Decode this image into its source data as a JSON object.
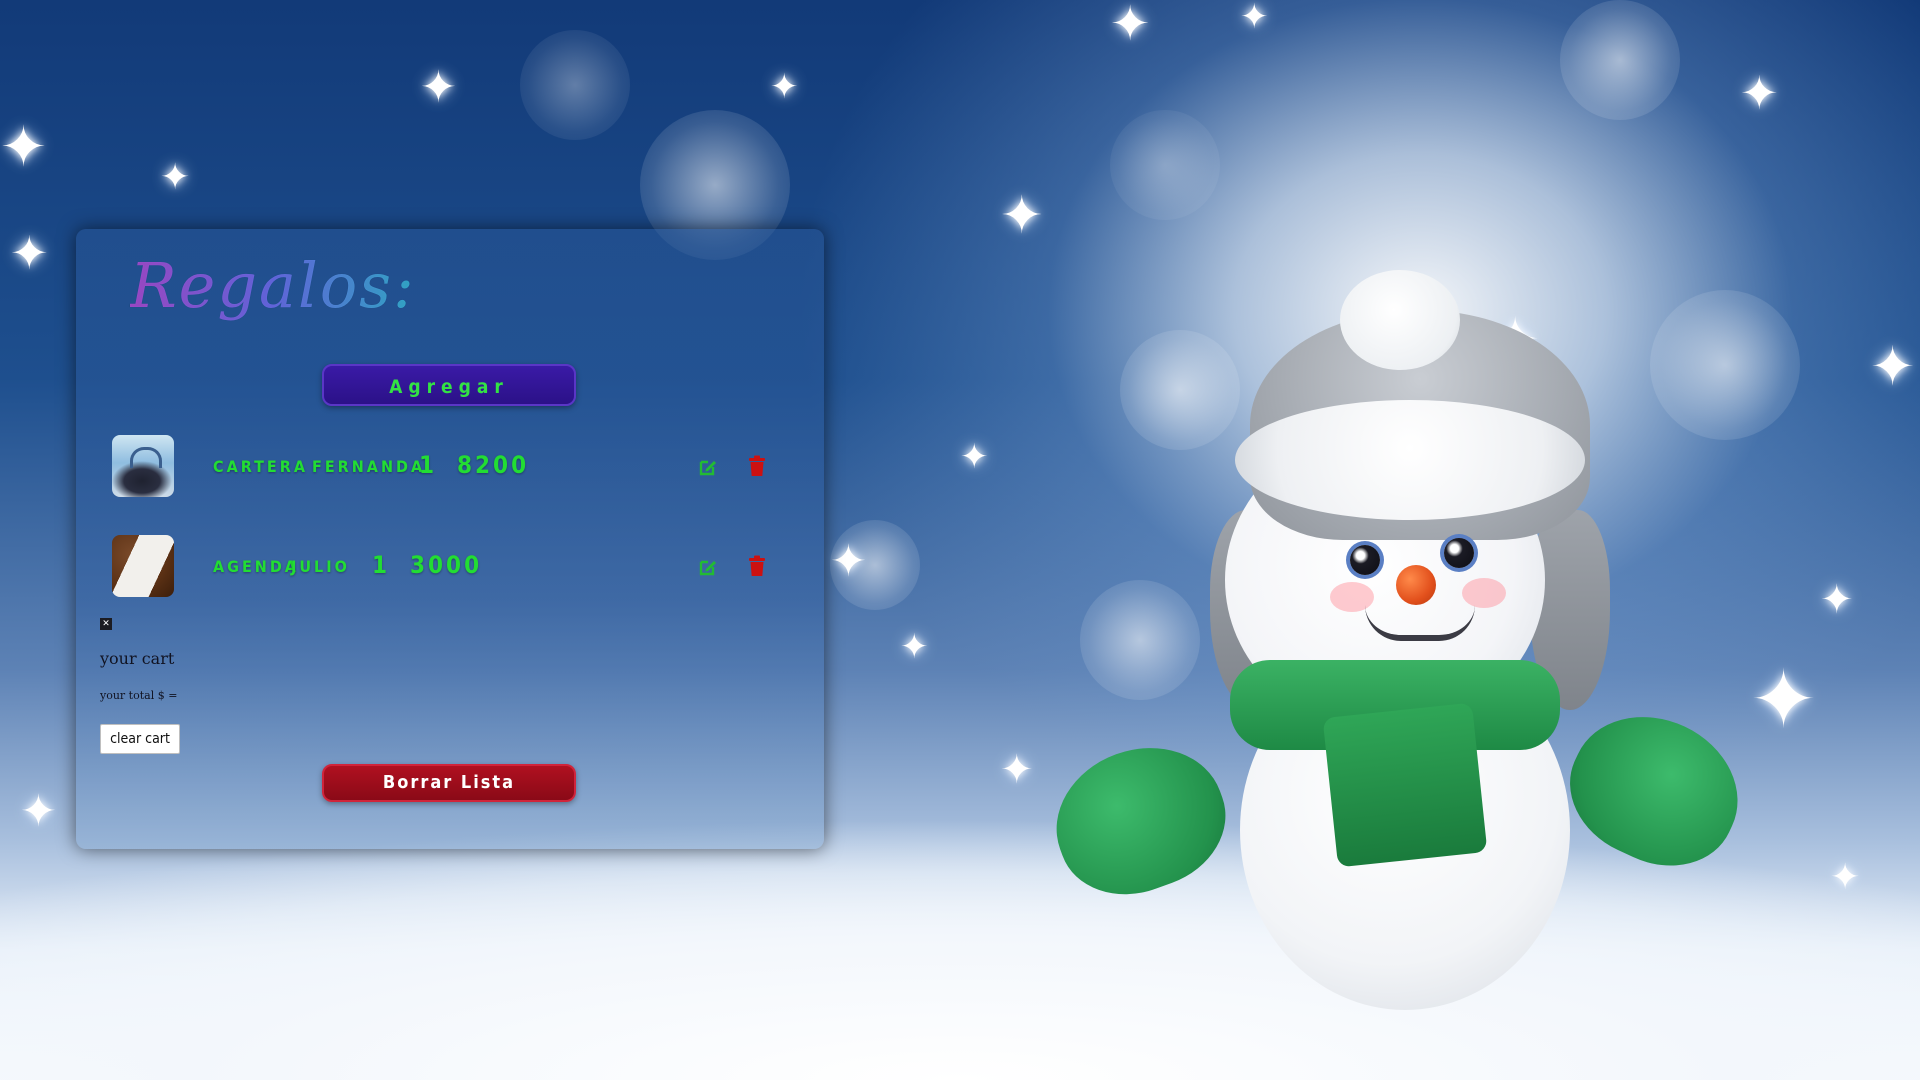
{
  "panel": {
    "title": "Regalos:",
    "add_button_label": "Agregar",
    "clear_list_button_label": "Borrar Lista"
  },
  "items": [
    {
      "name": "CARTERA",
      "recipient": "FERNANDA",
      "quantity": "1",
      "price": "8200",
      "image_icon": "bag-thumbnail"
    },
    {
      "name": "AGENDA",
      "recipient": "JULIO",
      "quantity": "1",
      "price": "3000",
      "image_icon": "agenda-thumbnail"
    }
  ],
  "cart": {
    "close_symbol": "✕",
    "title": "your cart",
    "total_label": "your total $ =",
    "clear_button_label": "clear cart"
  },
  "icons": {
    "edit": "edit-icon",
    "delete": "trash-icon"
  },
  "colors": {
    "item_text": "#22dd33",
    "add_button_bg": "#2b1188",
    "clear_list_bg": "#8a0a17",
    "edit_icon": "#22bb33",
    "trash_icon": "#cc1111"
  }
}
